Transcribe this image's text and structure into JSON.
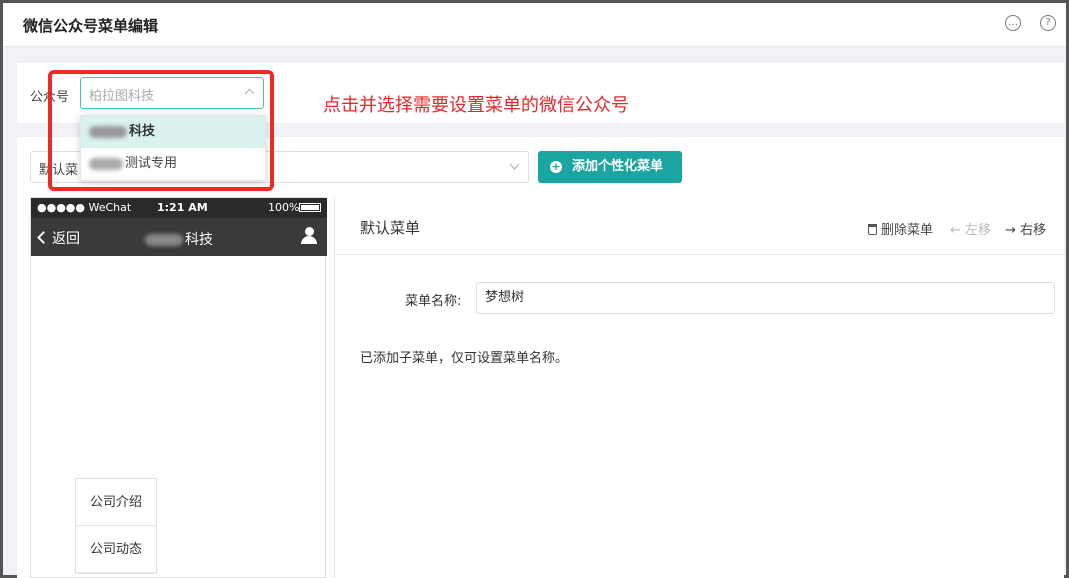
{
  "header": {
    "title": "微信公众号菜单编辑",
    "icons": [
      "chat-icon",
      "help-icon"
    ]
  },
  "account": {
    "label": "公众号",
    "placeholder": "柏拉图科技",
    "options": [
      {
        "label": "科技",
        "selected": true
      },
      {
        "label": "测试专用",
        "selected": false
      }
    ]
  },
  "annotation": "点击并选择需要设置菜单的微信公众号",
  "menu": {
    "select_value": "默认菜",
    "add_button": "添加个性化菜单"
  },
  "phone": {
    "carrier": "●●●●● WeChat",
    "time": "1:21 AM",
    "battery": "100%",
    "back": "返回",
    "account_name": "科技",
    "submenu": [
      "公司介绍",
      "公司动态"
    ]
  },
  "editor": {
    "title": "默认菜单",
    "delete": "删除菜单",
    "move_left": "← 左移",
    "move_right": "→ 右移",
    "name_label": "菜单名称:",
    "name_value": "梦想树",
    "hint": "已添加子菜单，仅可设置菜单名称。"
  },
  "colors": {
    "accent": "#1aa5a0",
    "annotation": "#e8262b",
    "highlight": "#ee2a24"
  }
}
